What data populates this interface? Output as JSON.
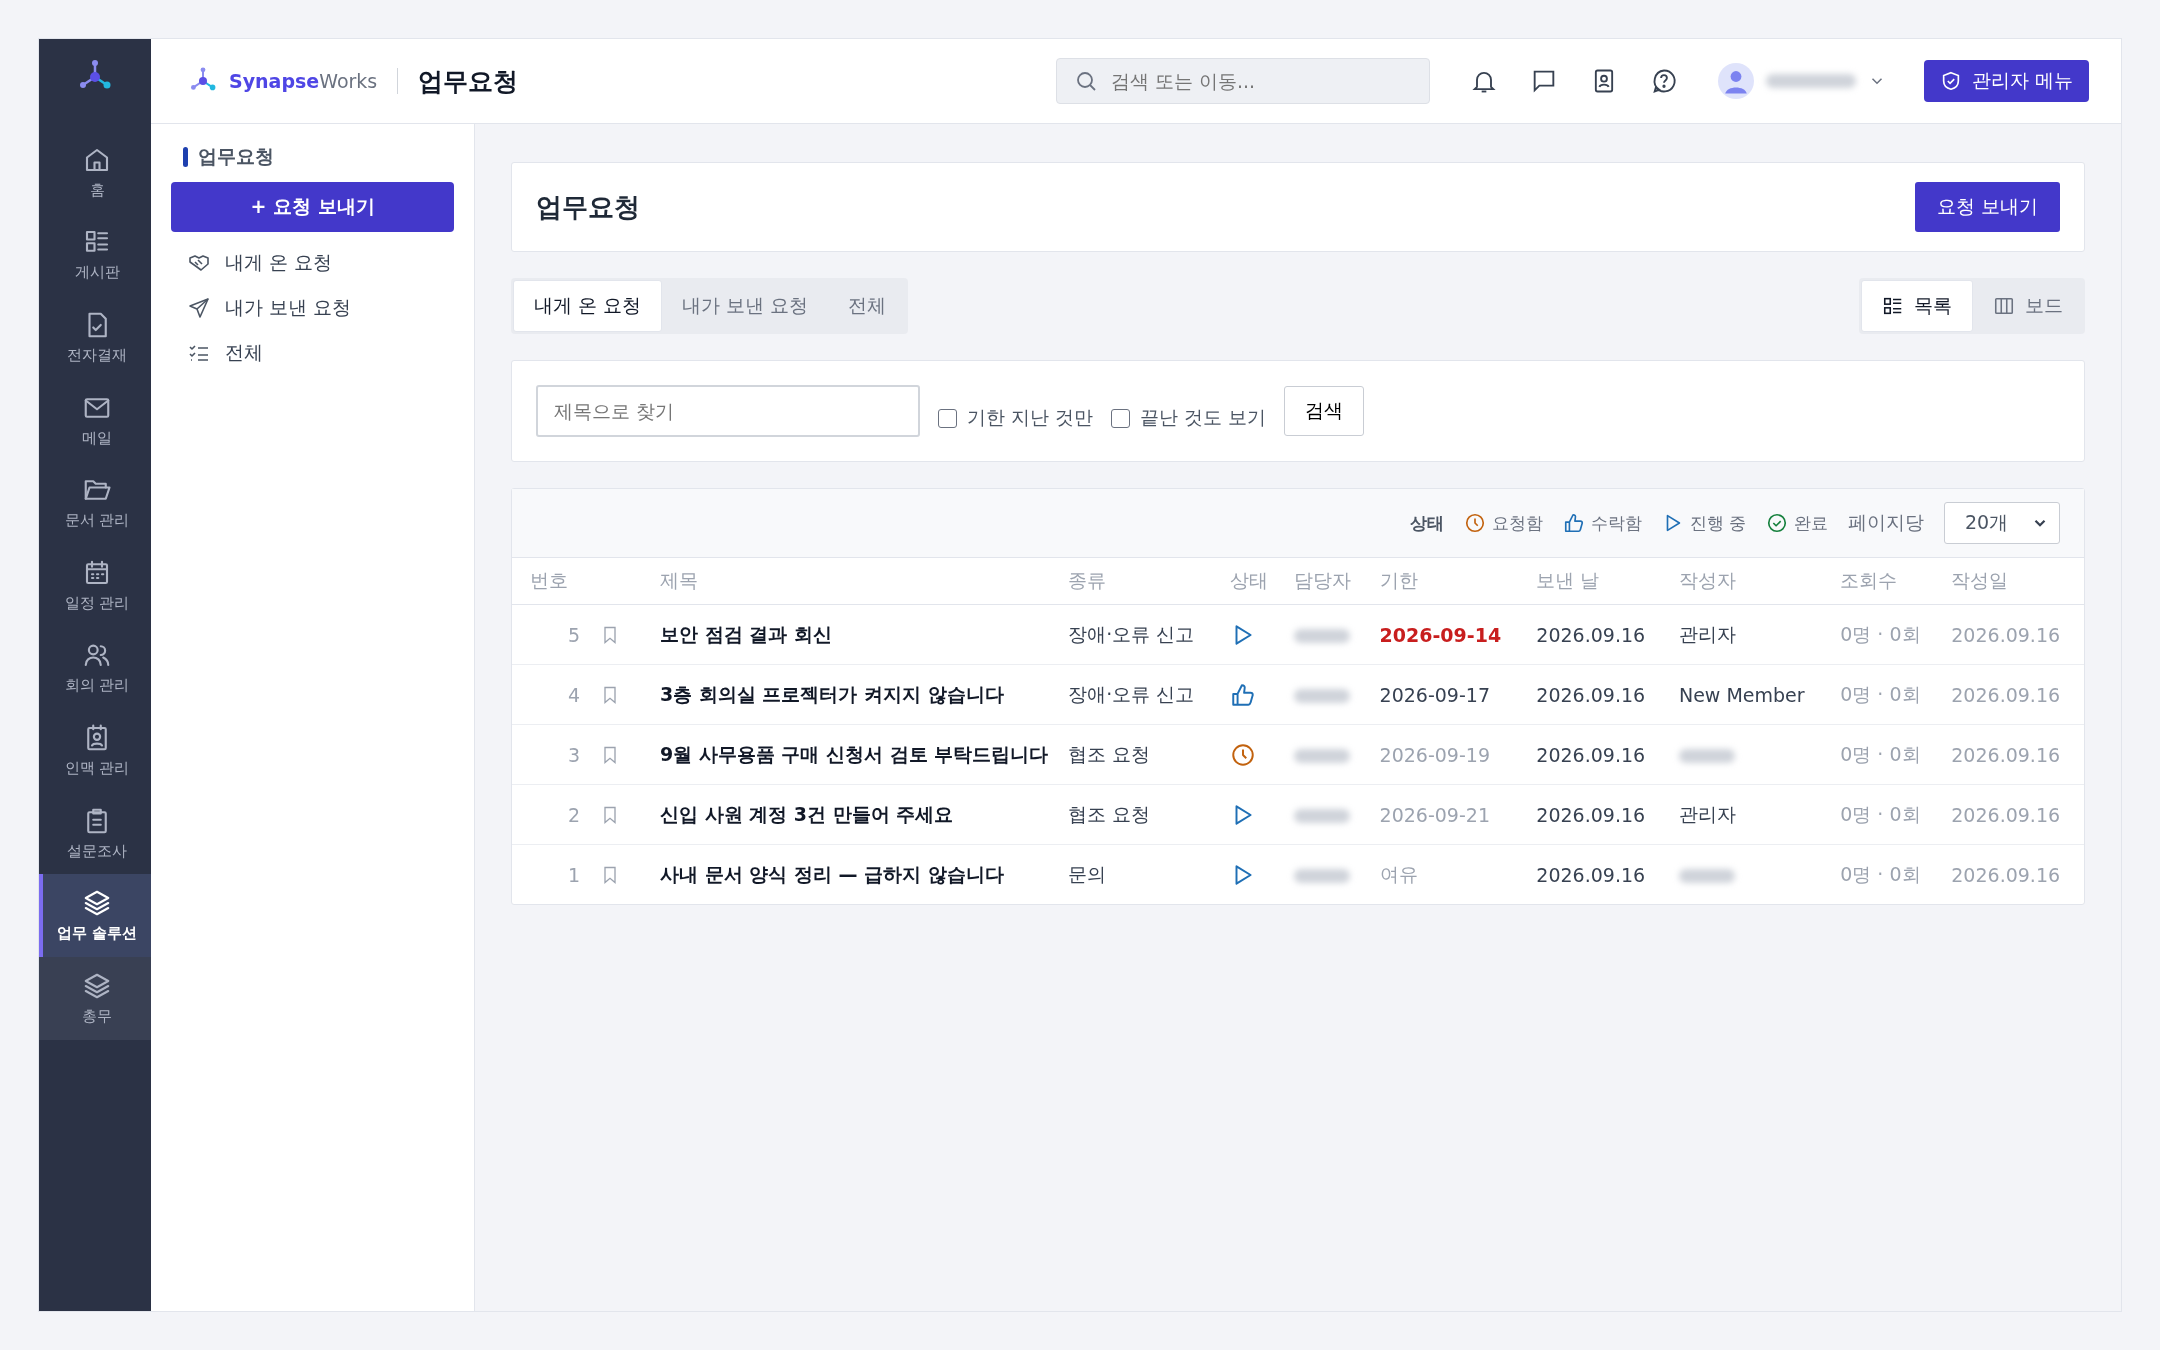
{
  "brand": {
    "name_bold": "Synapse",
    "name_rest": "Works"
  },
  "page_title": "업무요청",
  "search": {
    "placeholder": "검색 또는 이동..."
  },
  "user": {
    "name_hidden": true
  },
  "admin_button": "관리자 메뉴",
  "rail": [
    {
      "label": "홈",
      "selected": false
    },
    {
      "label": "게시판",
      "selected": false
    },
    {
      "label": "전자결재",
      "selected": false
    },
    {
      "label": "메일",
      "selected": false
    },
    {
      "label": "문서 관리",
      "selected": false
    },
    {
      "label": "일정 관리",
      "selected": false
    },
    {
      "label": "회의 관리",
      "selected": false
    },
    {
      "label": "인맥 관리",
      "selected": false
    },
    {
      "label": "설문조사",
      "selected": false
    },
    {
      "label": "업무 솔루션",
      "selected": true
    },
    {
      "label": "총무",
      "selected": false
    }
  ],
  "sidebar": {
    "heading": "업무요청",
    "new_button": "+ 요청 보내기",
    "items": [
      "내게 온 요청",
      "내가 보낸 요청",
      "전체"
    ]
  },
  "header_card": {
    "title": "업무요청",
    "button": "요청 보내기"
  },
  "tabs": [
    {
      "label": "내게 온 요청",
      "selected": true
    },
    {
      "label": "내가 보낸 요청",
      "selected": false
    },
    {
      "label": "전체",
      "selected": false
    }
  ],
  "views": [
    {
      "label": "목록",
      "selected": true
    },
    {
      "label": "보드",
      "selected": false
    }
  ],
  "filter": {
    "placeholder": "제목으로 찾기",
    "checks": [
      {
        "label": "기한 지난 것만",
        "checked": false
      },
      {
        "label": "끝난 것도 보기",
        "checked": false
      }
    ],
    "button": "검색"
  },
  "legend": {
    "label": "상태",
    "items": [
      {
        "kind": "requested",
        "label": "요청함"
      },
      {
        "kind": "accepted",
        "label": "수락함"
      },
      {
        "kind": "progress",
        "label": "진행 중"
      },
      {
        "kind": "done",
        "label": "완료"
      }
    ]
  },
  "per_page": {
    "label": "페이지당",
    "value": "20개"
  },
  "table": {
    "columns": [
      "번호",
      "제목",
      "종류",
      "상태",
      "담당자",
      "기한",
      "보낸 날",
      "작성자",
      "조회수",
      "작성일"
    ],
    "rows": [
      {
        "no": "5",
        "title": "보안 점검 결과 회신",
        "type": "장애·오류 신고",
        "status": {
          "kind": "progress"
        },
        "assignee_hidden": true,
        "deadline": {
          "kind": "overdue",
          "text": "2026-09-14"
        },
        "sent": "2026.09.16",
        "author": "관리자",
        "author_hidden": false,
        "views": "0명 · 0회",
        "created": "2026.09.16"
      },
      {
        "no": "4",
        "title": "3층 회의실 프로젝터가 켜지지 않습니다",
        "type": "장애·오류 신고",
        "status": {
          "kind": "accepted"
        },
        "assignee_hidden": true,
        "deadline": {
          "kind": "soon",
          "text": "2026-09-17"
        },
        "sent": "2026.09.16",
        "author": "New Member",
        "author_hidden": false,
        "views": "0명 · 0회",
        "created": "2026.09.16"
      },
      {
        "no": "3",
        "title": "9월 사무용품 구매 신청서 검토 부탁드립니다",
        "type": "협조 요청",
        "status": {
          "kind": "requested"
        },
        "assignee_hidden": true,
        "deadline": {
          "kind": "normal",
          "text": "2026-09-19"
        },
        "sent": "2026.09.16",
        "author_hidden": true,
        "views": "0명 · 0회",
        "created": "2026.09.16"
      },
      {
        "no": "2",
        "title": "신입 사원 계정 3건 만들어 주세요",
        "type": "협조 요청",
        "status": {
          "kind": "progress"
        },
        "assignee_hidden": true,
        "deadline": {
          "kind": "normal",
          "text": "2026-09-21"
        },
        "sent": "2026.09.16",
        "author": "관리자",
        "author_hidden": false,
        "views": "0명 · 0회",
        "created": "2026.09.16"
      },
      {
        "no": "1",
        "title": "사내 문서 양식 정리 — 급하지 않습니다",
        "type": "문의",
        "status": {
          "kind": "progress"
        },
        "assignee_hidden": true,
        "deadline": {
          "kind": "normal",
          "text": "여유"
        },
        "sent": "2026.09.16",
        "author_hidden": true,
        "views": "0명 · 0회",
        "created": "2026.09.16"
      }
    ]
  }
}
